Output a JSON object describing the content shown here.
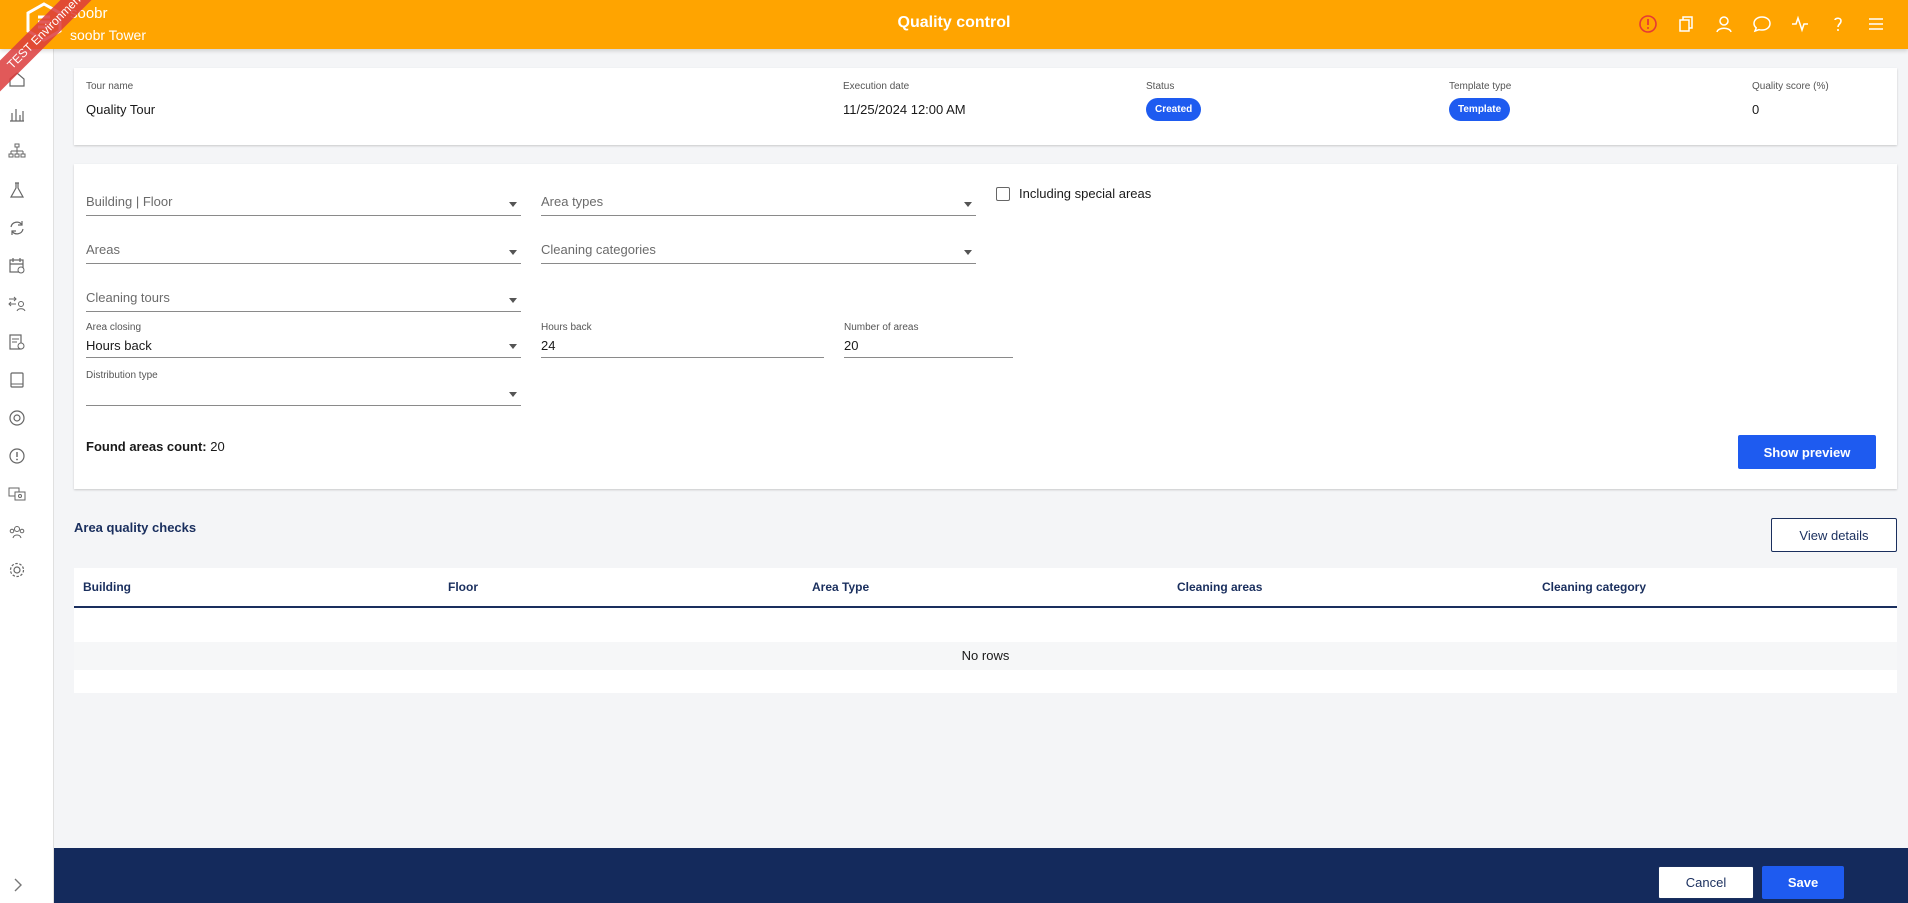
{
  "header": {
    "tenant_name": "soobr",
    "tenant_sub": "soobr Tower",
    "title": "Quality control",
    "env_ribbon": "TEST Environment",
    "icons": [
      "alert-icon",
      "copy-icon",
      "user-icon",
      "chat-icon",
      "activity-icon",
      "help-icon",
      "menu-icon"
    ],
    "alert_color": "#e53935"
  },
  "sidebar": {
    "icons": [
      "home-icon",
      "chart-icon",
      "hierarchy-icon",
      "lab-icon",
      "cycle-icon",
      "calendar-icon",
      "swap-user-icon",
      "report-icon",
      "tablet-icon",
      "target-icon",
      "alert-circle-icon",
      "image-icon",
      "team-icon",
      "settings-icon"
    ]
  },
  "info": {
    "tour_name_label": "Tour name",
    "tour_name": "Quality Tour",
    "execution_date_label": "Execution date",
    "execution_date": "11/25/2024 12:00 AM",
    "status_label": "Status",
    "status": "Created",
    "template_type_label": "Template type",
    "template_type": "Template",
    "quality_score_label": "Quality score (%)",
    "quality_score": "0"
  },
  "filters": {
    "building_floor": "Building | Floor",
    "area_types": "Area types",
    "including_special": "Including special areas",
    "areas": "Areas",
    "cleaning_categories": "Cleaning categories",
    "cleaning_tours": "Cleaning tours",
    "area_closing_label": "Area closing",
    "area_closing": "Hours back",
    "hours_back_label": "Hours back",
    "hours_back": "24",
    "number_of_areas_label": "Number of areas",
    "number_of_areas": "20",
    "distribution_type_label": "Distribution type",
    "distribution_type": "",
    "found_label": "Found areas count:",
    "found_count": "20",
    "show_preview": "Show preview"
  },
  "checks": {
    "title": "Area quality checks",
    "view_details": "View details",
    "columns": [
      "Building",
      "Floor",
      "Area Type",
      "Cleaning areas",
      "Cleaning category"
    ],
    "empty_text": "No rows"
  },
  "footer": {
    "cancel": "Cancel",
    "save": "Save"
  },
  "colors": {
    "brand": "#ffa400",
    "primary": "#1e5bf0",
    "navy": "#142a5c"
  }
}
